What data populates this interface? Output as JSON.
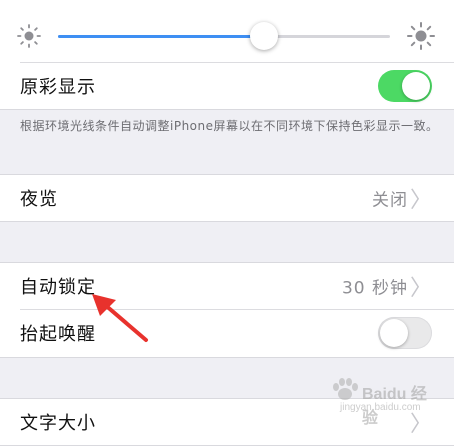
{
  "brightness": {
    "level": 0.62
  },
  "true_tone": {
    "label": "原彩显示",
    "enabled": true,
    "footnote": "根据环境光线条件自动调整iPhone屏幕以在不同环境下保持色彩显示一致。"
  },
  "night_shift": {
    "label": "夜览",
    "value": "关闭"
  },
  "auto_lock": {
    "label": "自动锁定",
    "value": "30 秒钟"
  },
  "raise_to_wake": {
    "label": "抬起唤醒",
    "enabled": false
  },
  "text_size": {
    "label": "文字大小"
  },
  "chevron": "〉",
  "watermark": {
    "text": "Baidu 经验",
    "sub": "jingyan.baidu.com"
  },
  "colors": {
    "toggle_on": "#4cd964",
    "slider_fill": "#3e8ff3",
    "arrow": "#e8322d"
  }
}
